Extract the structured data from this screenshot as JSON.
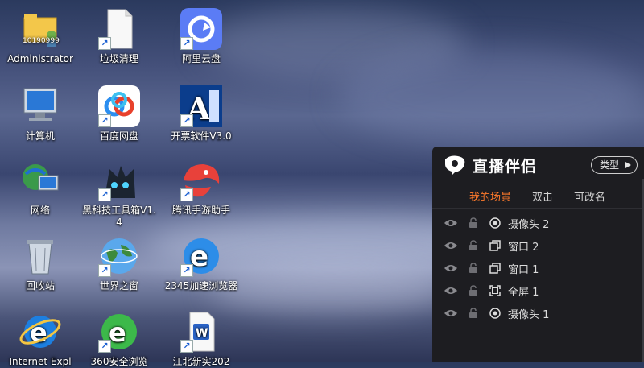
{
  "desktop": {
    "icons": [
      {
        "label": "Administrator",
        "sub": "10190999"
      },
      {
        "label": "垃圾清理"
      },
      {
        "label": "阿里云盘"
      },
      {
        "label": "计算机"
      },
      {
        "label": "百度网盘"
      },
      {
        "label": "开票软件V3.0"
      },
      {
        "label": "网络"
      },
      {
        "label": "黑科技工具箱V1.4"
      },
      {
        "label": "腾讯手游助手"
      },
      {
        "label": "回收站"
      },
      {
        "label": "世界之窗"
      },
      {
        "label": "2345加速浏览器"
      },
      {
        "label": "Internet Expl"
      },
      {
        "label": "360安全浏览"
      },
      {
        "label": "江北新实202"
      }
    ]
  },
  "panel": {
    "title": "直播伴侣",
    "type_button": "类型",
    "tabs": [
      "我的场景",
      "双击",
      "可改名"
    ],
    "scenes": [
      {
        "name": "摄像头 2",
        "kind": "camera"
      },
      {
        "name": "窗口 2",
        "kind": "window"
      },
      {
        "name": "窗口 1",
        "kind": "window"
      },
      {
        "name": "全屏 1",
        "kind": "fullscreen"
      },
      {
        "name": "摄像头 1",
        "kind": "camera"
      }
    ],
    "accent": "#ff7a2b"
  }
}
